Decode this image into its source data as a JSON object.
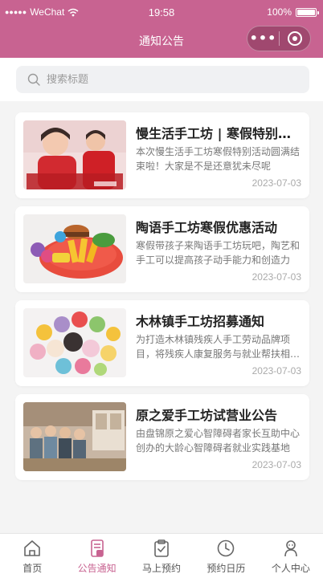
{
  "status_bar": {
    "signal": "●●●●●",
    "carrier": "WeChat",
    "time": "19:58",
    "battery": "100%",
    "battery_level": 1.0
  },
  "nav": {
    "title": "通知公告",
    "more_label": "•••"
  },
  "search": {
    "placeholder": "搜索标题",
    "value": ""
  },
  "notices": [
    {
      "title": "慢生活手工坊 | 寒假特别活动圆满结束啦",
      "desc": "本次慢生活手工坊寒假特别活动圆满结束啦！大家是不是还意犹未尽呢",
      "date": "2023-07-03",
      "thumb_icon": "children-crafts-photo"
    },
    {
      "title": "陶语手工坊寒假优惠活动",
      "desc": "寒假带孩子来陶语手工坊玩吧，陶艺和手工可以提高孩子动手能力和创造力",
      "date": "2023-07-03",
      "thumb_icon": "clay-food-photo"
    },
    {
      "title": "木林镇手工坊招募通知",
      "desc": "为打造木林镇残疾人手工劳动品牌项目，将残疾人康复服务与就业帮扶相结合",
      "date": "2023-07-03",
      "thumb_icon": "felt-dolls-photo"
    },
    {
      "title": "原之爱手工坊试营业公告",
      "desc": "由盘锦原之爱心智障碍者家长互助中心创办的大龄心智障碍者就业实践基地",
      "date": "2023-07-03",
      "thumb_icon": "workshop-team-photo"
    }
  ],
  "tabs": [
    {
      "label": "首页",
      "icon": "home-icon",
      "active": false
    },
    {
      "label": "公告通知",
      "icon": "notice-icon",
      "active": true
    },
    {
      "label": "马上预约",
      "icon": "booking-icon",
      "active": false
    },
    {
      "label": "预约日历",
      "icon": "clock-icon",
      "active": false
    },
    {
      "label": "个人中心",
      "icon": "user-icon",
      "active": false
    }
  ],
  "colors": {
    "brand": "#c86391",
    "background": "#f4f4f4",
    "text_primary": "#222222",
    "text_secondary": "#777777"
  }
}
